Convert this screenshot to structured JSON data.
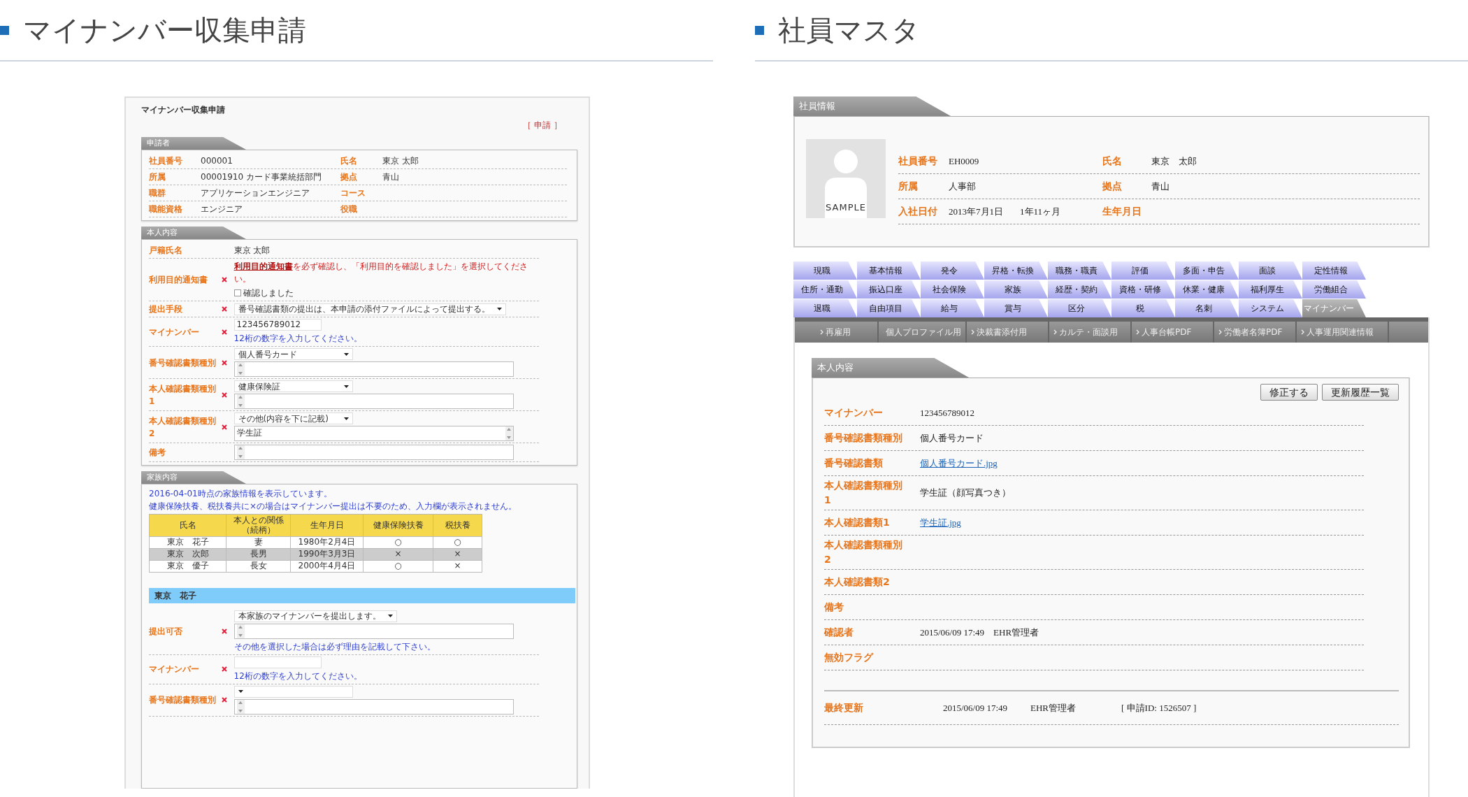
{
  "left_heading": "マイナンバー収集申請",
  "right_heading": "社員マスタ",
  "application_form": {
    "title": "マイナンバー収集申請",
    "status": "［ 申請 ］",
    "applicant": {
      "title": "申請者",
      "rows": [
        [
          {
            "label": "社員番号",
            "value": "000001"
          },
          {
            "label": "氏名",
            "value": "東京 太郎"
          }
        ],
        [
          {
            "label": "所属",
            "value": "00001910 カード事業統括部門"
          },
          {
            "label": "拠点",
            "value": "青山"
          }
        ],
        [
          {
            "label": "職群",
            "value": "アプリケーションエンジニア"
          },
          {
            "label": "コース"
          }
        ],
        [
          {
            "label": "職能資格",
            "value": "エンジニア"
          },
          {
            "label": "役職"
          }
        ]
      ]
    },
    "personal": {
      "title": "本人内容",
      "fields": [
        {
          "kind": "text",
          "label": "戸籍氏名",
          "required": false,
          "value": "東京 太郎"
        },
        {
          "kind": "consent",
          "label": "利用目的通知書",
          "required": true,
          "link": "利用目的通知書",
          "message": "を必ず確認し、「利用目的を確認しました」を選択してください。",
          "checkbox_label": "確認しました",
          "checked": false
        },
        {
          "kind": "select",
          "label": "提出手段",
          "required": true,
          "select": "番号確認書類の提出は、本申請の添付ファイルによって提出する。"
        },
        {
          "kind": "input",
          "label": "マイナンバー",
          "required": true,
          "value": "123456789012",
          "hint": "12桁の数字を入力してください。"
        },
        {
          "kind": "select_textarea",
          "label": "番号確認書類種別",
          "required": true,
          "select": "個人番号カード"
        },
        {
          "kind": "select_textarea",
          "label": "本人確認書類種別1",
          "required": true,
          "select": "健康保険証"
        },
        {
          "kind": "select_textarea",
          "label": "本人確認書類種別2",
          "required": true,
          "select": "その他(内容を下に記載)",
          "textarea": "学生証"
        },
        {
          "kind": "textarea",
          "label": "備考",
          "required": false
        }
      ]
    },
    "family": {
      "title": "家族内容",
      "notes": [
        "2016-04-01時点の家族情報を表示しています。",
        "健康保険扶養、税扶養共に×の場合はマイナンバー提出は不要のため、入力欄が表示されません。"
      ],
      "columns": [
        "氏名",
        "本人との関係（続柄）",
        "生年月日",
        "健康保険扶養",
        "税扶養"
      ],
      "rows": [
        {
          "cells": [
            "東京　花子",
            "妻",
            "1980年2月4日",
            "○",
            "○"
          ],
          "selected": false
        },
        {
          "cells": [
            "東京　次郎",
            "長男",
            "1990年3月3日",
            "×",
            "×"
          ],
          "selected": true
        },
        {
          "cells": [
            "東京　優子",
            "長女",
            "2000年4月4日",
            "○",
            "×"
          ],
          "selected": false
        }
      ],
      "member": {
        "name": "東京　花子",
        "fields": [
          {
            "kind": "select_textarea",
            "label": "提出可否",
            "required": true,
            "select": "本家族のマイナンバーを提出します。",
            "hint": "その他を選択した場合は必ず理由を記載して下さい。"
          },
          {
            "kind": "input",
            "label": "マイナンバー",
            "required": true,
            "hint": "12桁の数字を入力してください。"
          },
          {
            "kind": "select_textarea",
            "label": "番号確認書類種別",
            "required": true
          }
        ]
      }
    }
  },
  "employee_master": {
    "info_title": "社員情報",
    "avatar_caption": "SAMPLE",
    "info_rows": [
      [
        {
          "label": "社員番号",
          "value": "EH0009"
        },
        {
          "label": "氏名",
          "value": "東京　太郎"
        }
      ],
      [
        {
          "label": "所属",
          "value": "人事部"
        },
        {
          "label": "拠点",
          "value": "青山"
        }
      ],
      [
        {
          "label": "入社日付",
          "value": "2013年7月1日",
          "extra": "1年11ヶ月"
        },
        {
          "label": "生年月日"
        }
      ]
    ],
    "tabs": [
      {
        "label": "現職",
        "selected": false
      },
      {
        "label": "基本情報",
        "selected": false
      },
      {
        "label": "発令",
        "selected": false
      },
      {
        "label": "昇格・転換",
        "selected": false
      },
      {
        "label": "職務・職責",
        "selected": false
      },
      {
        "label": "評価",
        "selected": false
      },
      {
        "label": "多面・申告",
        "selected": false
      },
      {
        "label": "面談",
        "selected": false
      },
      {
        "label": "定性情報",
        "selected": false
      },
      {
        "label": "住所・通勤",
        "selected": false
      },
      {
        "label": "振込口座",
        "selected": false
      },
      {
        "label": "社会保険",
        "selected": false
      },
      {
        "label": "家族",
        "selected": false
      },
      {
        "label": "経歴・契約",
        "selected": false
      },
      {
        "label": "資格・研修",
        "selected": false
      },
      {
        "label": "休業・健康",
        "selected": false
      },
      {
        "label": "福利厚生",
        "selected": false
      },
      {
        "label": "労働組合",
        "selected": false
      },
      {
        "label": "退職",
        "selected": false
      },
      {
        "label": "自由項目",
        "selected": false
      },
      {
        "label": "給与",
        "selected": false
      },
      {
        "label": "賞与",
        "selected": false
      },
      {
        "label": "区分",
        "selected": false
      },
      {
        "label": "税",
        "selected": false
      },
      {
        "label": "名刺",
        "selected": false
      },
      {
        "label": "システム",
        "selected": false
      },
      {
        "label": "マイナンバー",
        "selected": true
      }
    ],
    "subnav": [
      "再雇用",
      "個人プロファイル用",
      "決裁書添付用",
      "カルテ・面談用",
      "人事台帳PDF",
      "労働者名簿PDF",
      "人事運用関連情報"
    ],
    "section": {
      "title": "本人内容",
      "buttons": [
        "修正する",
        "更新履歴一覧"
      ],
      "rows": [
        {
          "kind": "text",
          "label": "マイナンバー",
          "value": "123456789012"
        },
        {
          "kind": "text",
          "label": "番号確認書類種別",
          "value": "個人番号カード"
        },
        {
          "kind": "link",
          "label": "番号確認書類",
          "value": "個人番号カード.jpg"
        },
        {
          "kind": "text",
          "label": "本人確認書類種別1",
          "value": "学生証（顔写真つき）"
        },
        {
          "kind": "link",
          "label": "本人確認書類1",
          "value": "学生証.jpg"
        },
        {
          "kind": "text",
          "label": "本人確認書類種別2"
        },
        {
          "kind": "text",
          "label": "本人確認書類2"
        },
        {
          "kind": "text",
          "label": "備考"
        },
        {
          "kind": "text",
          "label": "確認者",
          "value": "2015/06/09 17:49　EHR管理者"
        },
        {
          "kind": "text",
          "label": "無効フラグ"
        }
      ],
      "footer": {
        "label": "最終更新",
        "values": [
          "2015/06/09 17:49",
          "EHR管理者",
          "[ 申請ID: 1526507 ]"
        ]
      }
    }
  }
}
